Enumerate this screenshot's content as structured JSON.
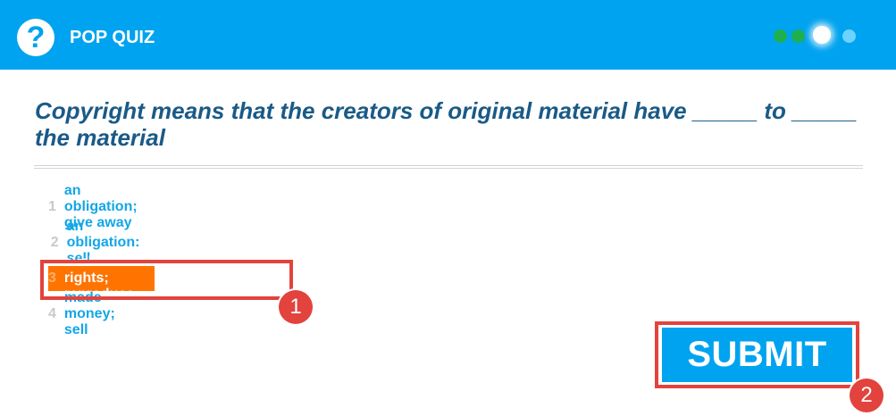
{
  "header": {
    "title": "POP QUIZ",
    "help_icon": "?",
    "progress": {
      "total": 4,
      "completed": 2,
      "current": 3
    }
  },
  "question": {
    "text": "Copyright means that the creators of original material have _____ to _____ the material"
  },
  "answers": [
    {
      "number": "1",
      "label": "an obligation; give away",
      "selected": false
    },
    {
      "number": "2",
      "label": "an obligation: sell",
      "selected": false
    },
    {
      "number": "3",
      "label": "exclusive rights; reproduce",
      "selected": true
    },
    {
      "number": "4",
      "label": "made money; sell",
      "selected": false
    }
  ],
  "submit_label": "SUBMIT",
  "annotations": [
    {
      "number": "1",
      "target": "answer-3"
    },
    {
      "number": "2",
      "target": "submit-button"
    }
  ],
  "colors": {
    "header": "#00a3ef",
    "question_text": "#1a5a86",
    "answer_text": "#12a6e8",
    "selected_background": "#ff7400",
    "progress_done": "#1eb04f",
    "progress_pending": "#6cd3ff",
    "annotation": "#e2433d"
  }
}
